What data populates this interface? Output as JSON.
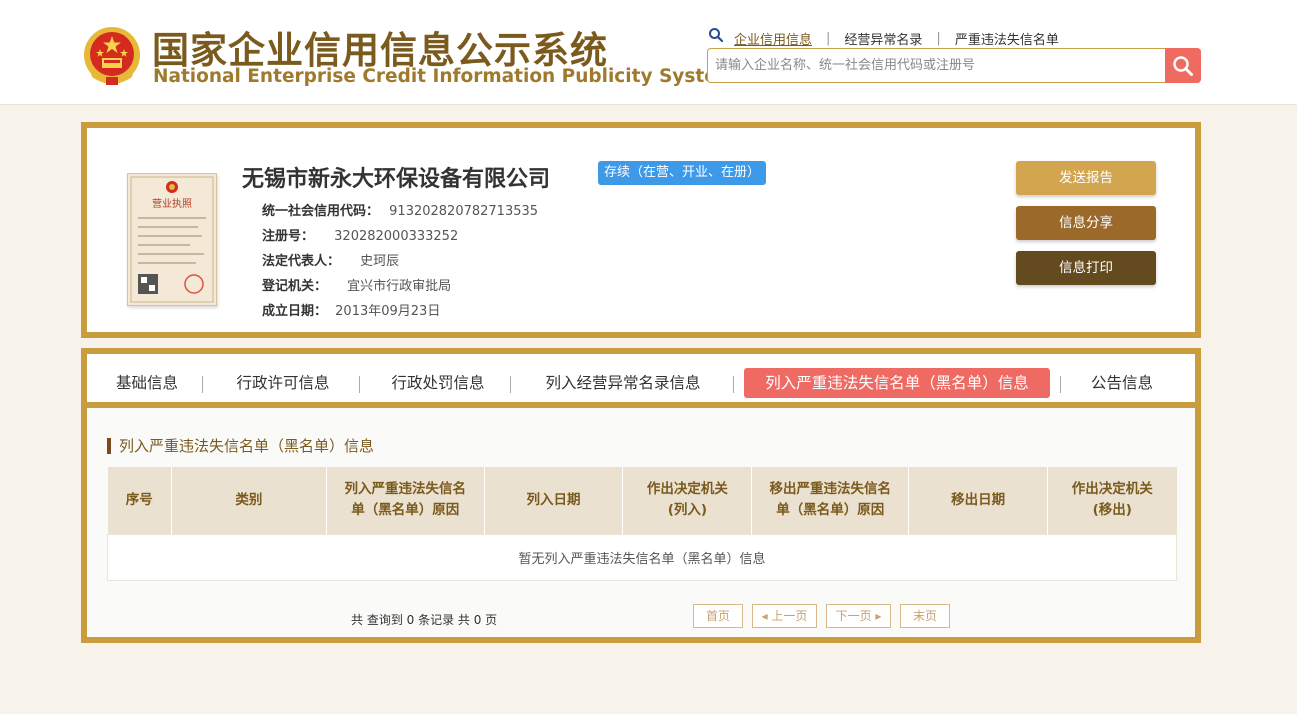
{
  "header": {
    "title_cn": "国家企业信用信息公示系统",
    "title_en": "National Enterprise Credit Information Publicity System",
    "links": [
      "企业信用信息",
      "经营异常名录",
      "严重违法失信名单"
    ],
    "search_placeholder": "请输入企业名称、统一社会信用代码或注册号",
    "emblem_icon": "national-emblem-icon",
    "search_icon": "magnifier-icon"
  },
  "company": {
    "name": "无锡市新永大环保设备有限公司",
    "status": "存续（在营、开业、在册）",
    "license_title": "营业执照",
    "fields": [
      {
        "label": "统一社会信用代码：",
        "value": "913202820782713535"
      },
      {
        "label": "注册号：",
        "value": "320282000333252"
      },
      {
        "label": "法定代表人：",
        "value": "史珂辰"
      },
      {
        "label": "登记机关：",
        "value": "宜兴市行政审批局"
      },
      {
        "label": "成立日期：",
        "value": "2013年09月23日"
      }
    ],
    "actions": [
      "发送报告",
      "信息分享",
      "信息打印"
    ]
  },
  "tabs": [
    "基础信息",
    "行政许可信息",
    "行政处罚信息",
    "列入经营异常名录信息",
    "列入严重违法失信名单（黑名单）信息",
    "公告信息"
  ],
  "active_tab": "列入严重违法失信名单（黑名单）信息",
  "section": {
    "title": "列入严重违法失信名单（黑名单）信息",
    "columns": [
      "序号",
      "类别",
      "列入严重违法失信名单（黑名单）原因",
      "列入日期",
      "作出决定机关(列入)",
      "移出严重违法失信名单（黑名单）原因",
      "移出日期",
      "作出决定机关(移出)"
    ],
    "column_lines": [
      [
        "序号"
      ],
      [
        "类别"
      ],
      [
        "列入严重违法失信名",
        "单（黑名单）原因"
      ],
      [
        "列入日期"
      ],
      [
        "作出决定机关",
        "(列入)"
      ],
      [
        "移出严重违法失信名",
        "单（黑名单）原因"
      ],
      [
        "移出日期"
      ],
      [
        "作出决定机关",
        "(移出)"
      ]
    ],
    "empty_text": "暂无列入严重违法失信名单（黑名单）信息"
  },
  "pagination": {
    "summary": "共 查询到 0 条记录 共 0 页",
    "first": "首页",
    "prev": "上一页",
    "next": "下一页",
    "last": "末页"
  },
  "colors": {
    "gold_border": "#c99c3d",
    "active_tab": "#f06a64",
    "status_badge": "#3e9ae8",
    "search_button": "#ef6a5f"
  }
}
